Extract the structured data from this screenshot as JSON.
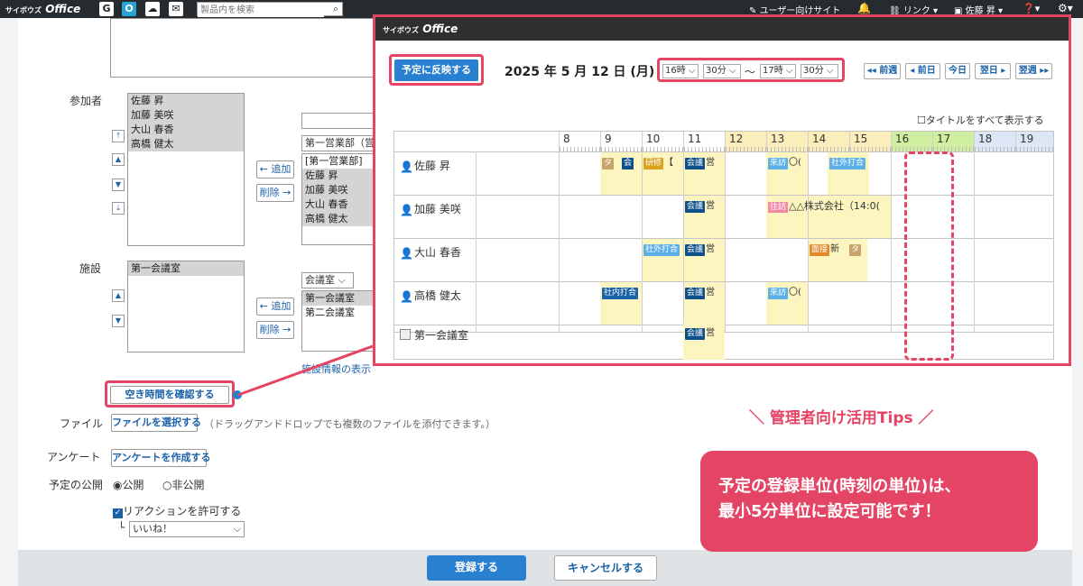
{
  "topbar": {
    "logo": "サイボウズ Office",
    "logo_small": "サイボウズ",
    "logo_big": "Office",
    "search_placeholder": "製品内を検索",
    "user_site": "ユーザー向けサイト",
    "link": "リンク",
    "user": "佐藤 昇"
  },
  "form": {
    "participants_label": "参加者",
    "participants": [
      "佐藤 昇",
      "加藤 美咲",
      "大山 春香",
      "高橋 健太"
    ],
    "group_select": "第一営業部（営",
    "candidates": [
      "[第一営業部]",
      "佐藤 昇",
      "加藤 美咲",
      "大山 春香",
      "高橋 健太"
    ],
    "add_label": "← 追加",
    "remove_label": "削除 →",
    "facility_label": "施設",
    "facilities": [
      "第一会議室"
    ],
    "facility_group": "会議室",
    "facility_candidates": [
      "第一会議室",
      "第二会議室"
    ],
    "facility_info_link": "施設情報の表示",
    "check_free_button": "空き時間を確認する",
    "file_label": "ファイル",
    "file_button": "ファイルを選択する",
    "file_hint": "（ドラッグアンドドロップでも複数のファイルを添付できます。）",
    "survey_label": "アンケート",
    "survey_button": "アンケートを作成する",
    "publish_label": "予定の公開",
    "public_label": "公開",
    "private_label": "非公開",
    "reaction_label": "リアクションを許可する",
    "reaction_select": "いいね！",
    "register_button": "登録する",
    "cancel_button": "キャンセルする"
  },
  "popup": {
    "title_small": "サイボウズ",
    "title_big": "Office",
    "apply_button": "予定に反映する",
    "date": "2025 年 5 月 12 日 (月)",
    "start_hour": "16時",
    "start_min": "30分",
    "tilde": "〜",
    "end_hour": "17時",
    "end_min": "30分",
    "nav": [
      "◂◂ 前週",
      "◂ 前日",
      "今日",
      "翌日 ▸",
      "翌週 ▸▸"
    ],
    "show_titles_label": "タイトルをすべて表示する",
    "hours": [
      "8",
      "9",
      "10",
      "11",
      "12",
      "13",
      "14",
      "15",
      "16",
      "17",
      "18",
      "19"
    ],
    "rows": [
      {
        "name": "佐藤 昇",
        "events": [
          {
            "tag": "タ",
            "text": ""
          },
          {
            "tag": "会",
            "text": ""
          },
          {
            "tag": "研修",
            "text": "【"
          },
          {
            "tag": "会議",
            "text": "営"
          },
          {
            "tag": "来訪",
            "text": "〇("
          },
          {
            "tag": "社外打合",
            "text": ""
          }
        ]
      },
      {
        "name": "加藤 美咲",
        "events": [
          {
            "tag": "会議",
            "text": "営"
          },
          {
            "tag": "往訪",
            "text": "△△株式会社（14:0("
          }
        ]
      },
      {
        "name": "大山 春香",
        "events": [
          {
            "tag": "社外打合",
            "text": ""
          },
          {
            "tag": "会議",
            "text": "営"
          },
          {
            "tag": "面接",
            "text": "新"
          },
          {
            "tag": "タ",
            "text": ""
          }
        ]
      },
      {
        "name": "高橋 健太",
        "events": [
          {
            "tag": "社内打合",
            "text": ""
          },
          {
            "tag": "会議",
            "text": "営"
          },
          {
            "tag": "来訪",
            "text": "〇("
          }
        ]
      },
      {
        "name": "第一会議室",
        "events": [
          {
            "tag": "会議",
            "text": "営"
          }
        ]
      }
    ]
  },
  "tips": {
    "label": "＼ 管理者向け活用Tips ／",
    "line1": "予定の登録単位(時刻の単位)は、",
    "line2": "最小5分単位に設定可能です！"
  },
  "colors": {
    "accent": "#e54565",
    "primary": "#2a80d0",
    "meeting": "#0d4f8b",
    "visit": "#5bb0e8",
    "training": "#d9a320",
    "outside": "#e58a2a"
  }
}
